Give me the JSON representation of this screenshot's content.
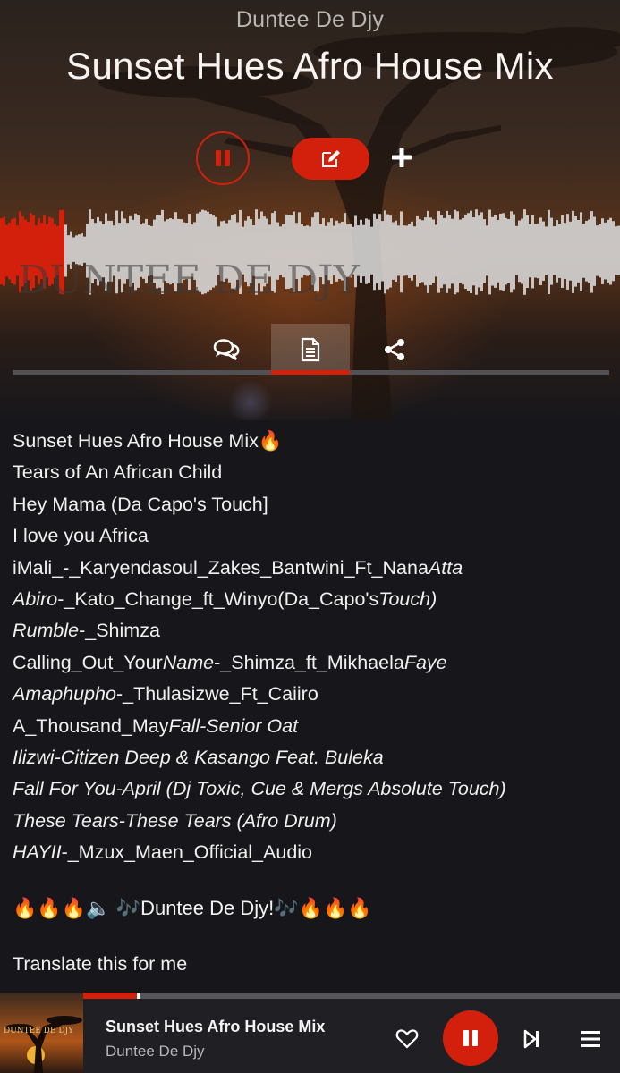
{
  "header": {
    "artist": "Duntee De Djy",
    "title": "Sunset Hues Afro House Mix"
  },
  "hero_watermark": "DUNTEE DE DJY",
  "controls": {
    "play_icon": "pause-icon",
    "edit_icon": "edit-icon",
    "add_icon": "plus-icon"
  },
  "waveform": {
    "played_fraction": 0.1
  },
  "tabs": [
    {
      "name": "comments",
      "icon": "comments-icon",
      "active": false
    },
    {
      "name": "description",
      "icon": "document-icon",
      "active": true
    },
    {
      "name": "share",
      "icon": "share-icon",
      "active": false
    }
  ],
  "description": {
    "lines": [
      [
        {
          "t": "Sunset Hues Afro House Mix🔥"
        }
      ],
      [
        {
          "t": "Tears of An African Child"
        }
      ],
      [
        {
          "t": "Hey Mama (Da Capo's Touch]"
        }
      ],
      [
        {
          "t": "I love you Africa"
        }
      ],
      [
        {
          "t": "iMali_-_Karyendasoul_Zakes_Bantwini_Ft_Nana"
        },
        {
          "t": "Atta",
          "i": true
        }
      ],
      [
        {
          "t": "Abiro",
          "i": true
        },
        {
          "t": "-_Kato_Change_ft_Winyo(Da_Capo's"
        },
        {
          "t": "Touch)",
          "i": true
        }
      ],
      [
        {
          "t": "Rumble",
          "i": true
        },
        {
          "t": "-_Shimza"
        }
      ],
      [
        {
          "t": "Calling_Out_Your"
        },
        {
          "t": "Name",
          "i": true
        },
        {
          "t": "-_Shimza_ft_Mikhaela"
        },
        {
          "t": "Faye",
          "i": true
        }
      ],
      [
        {
          "t": "Amaphupho",
          "i": true
        },
        {
          "t": "-_Thulasizwe_Ft_Caiiro"
        }
      ],
      [
        {
          "t": "A_Thousand_May"
        },
        {
          "t": "Fall-Senior Oat",
          "i": true
        }
      ],
      [
        {
          "t": "Ilizwi-Citizen Deep & Kasango Feat. Buleka",
          "i": true
        }
      ],
      [
        {
          "t": "Fall For You-April (Dj Toxic, Cue & Mergs Absolute Touch)",
          "i": true
        }
      ],
      [
        {
          "t": "These Tears-These Tears (Afro Drum)",
          "i": true
        }
      ],
      [
        {
          "t": "HAYII",
          "i": true
        },
        {
          "t": "-_Mzux_Maen_Official_Audio"
        }
      ]
    ],
    "signature": "🔥🔥🔥🔈 🎶Duntee De Djy!🎶🔥🔥🔥"
  },
  "translate_link": "Translate this for me",
  "mini_player": {
    "title": "Sunset Hues Afro House Mix",
    "artist": "Duntee De Djy",
    "cover_text": "DUNTEE DE DJY",
    "progress_fraction": 0.1,
    "like_icon": "heart-icon",
    "play_icon": "pause-icon",
    "next_icon": "skip-next-icon",
    "queue_icon": "menu-icon"
  },
  "colors": {
    "accent": "#d2200c",
    "background": "#17171b",
    "waveform_unplayed": "#d9d9d9"
  }
}
